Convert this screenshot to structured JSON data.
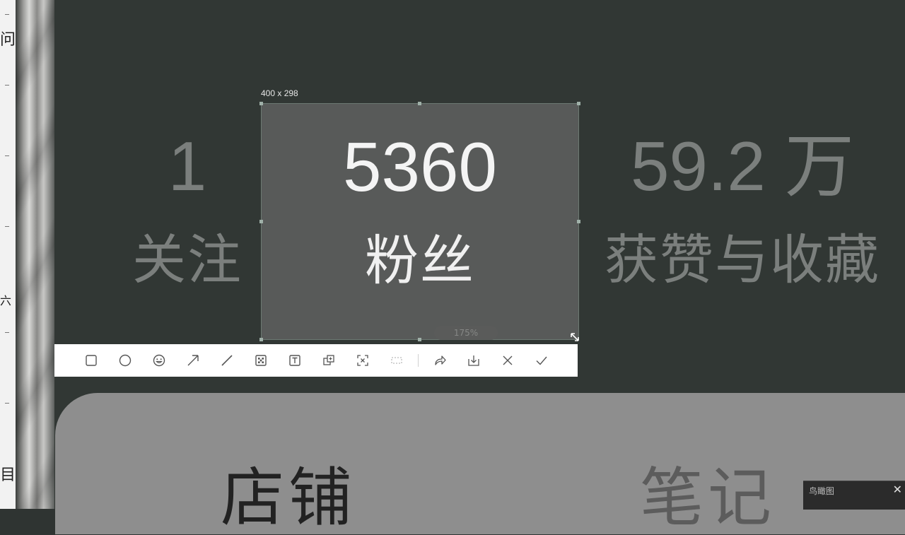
{
  "screenshot_tool": {
    "selection_size": "400 x 298",
    "zoom_level": "175%",
    "toolbar_tools": [
      {
        "name": "rectangle"
      },
      {
        "name": "ellipse"
      },
      {
        "name": "emoji"
      },
      {
        "name": "arrow"
      },
      {
        "name": "line"
      },
      {
        "name": "mosaic"
      },
      {
        "name": "text"
      },
      {
        "name": "pin"
      },
      {
        "name": "ocr"
      },
      {
        "name": "long-screenshot"
      },
      {
        "name": "share"
      },
      {
        "name": "save"
      },
      {
        "name": "cancel"
      },
      {
        "name": "confirm"
      }
    ]
  },
  "profile_stats": {
    "following": {
      "value": "1",
      "label": "关注"
    },
    "followers": {
      "value": "5360",
      "label": "粉丝"
    },
    "likes": {
      "value": "59.2 万",
      "label": "获赞与收藏"
    }
  },
  "card": {
    "tab_shop": "店铺",
    "tab_notes": "笔记"
  },
  "mini_window": {
    "title": "鸟瞰图"
  },
  "left_window_fragments": [
    "问",
    "六",
    "目"
  ],
  "colors": {
    "background": "#313734",
    "selection_fill": "#585a59",
    "toolbar": "#ffffff",
    "card": "#8e8e8e"
  }
}
